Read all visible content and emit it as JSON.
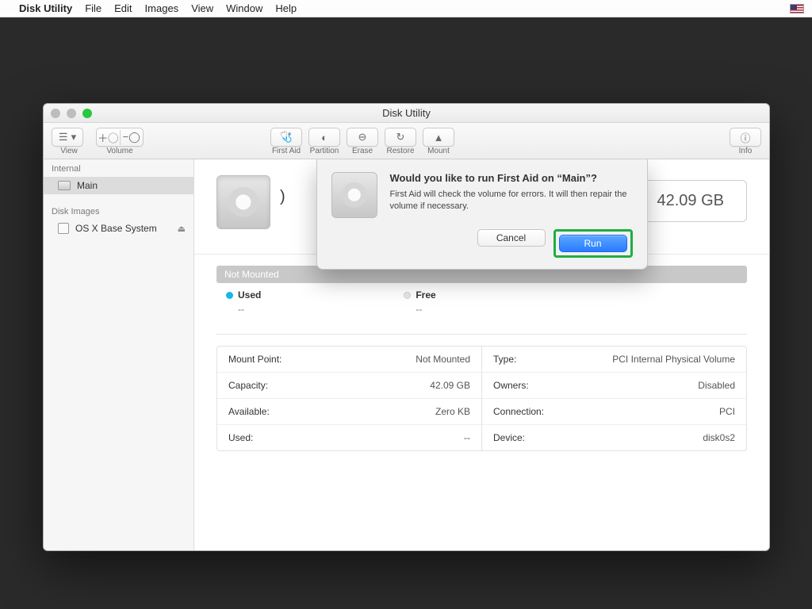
{
  "menubar": {
    "app": "Disk Utility",
    "items": [
      "File",
      "Edit",
      "Images",
      "View",
      "Window",
      "Help"
    ]
  },
  "window": {
    "title": "Disk Utility",
    "toolbar": {
      "view": "View",
      "volume": "Volume",
      "first_aid": "First Aid",
      "partition": "Partition",
      "erase": "Erase",
      "restore": "Restore",
      "mount": "Mount",
      "info": "Info"
    }
  },
  "sidebar": {
    "section_internal": "Internal",
    "item_main": "Main",
    "section_images": "Disk Images",
    "item_osx_base": "OS X Base System"
  },
  "hero": {
    "paren": ")",
    "size": "42.09 GB"
  },
  "status_bar": "Not Mounted",
  "legend": {
    "used_label": "Used",
    "used_value": "--",
    "free_label": "Free",
    "free_value": "--"
  },
  "info_left": {
    "k0": "Mount Point:",
    "v0": "Not Mounted",
    "k1": "Capacity:",
    "v1": "42.09 GB",
    "k2": "Available:",
    "v2": "Zero KB",
    "k3": "Used:",
    "v3": "--"
  },
  "info_right": {
    "k0": "Type:",
    "v0": "PCI Internal Physical Volume",
    "k1": "Owners:",
    "v1": "Disabled",
    "k2": "Connection:",
    "v2": "PCI",
    "k3": "Device:",
    "v3": "disk0s2"
  },
  "dialog": {
    "title": "Would you like to run First Aid on “Main”?",
    "body": "First Aid will check the volume for errors. It will then repair the volume if necessary.",
    "cancel": "Cancel",
    "run": "Run"
  }
}
